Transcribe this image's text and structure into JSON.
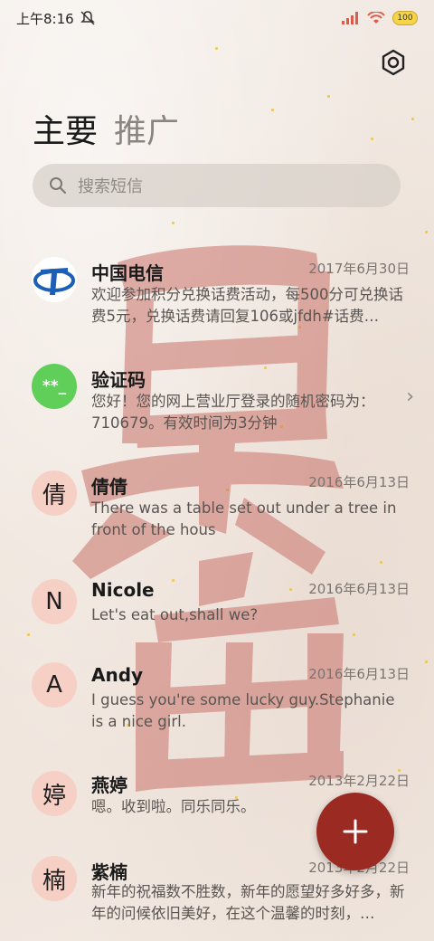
{
  "status_bar": {
    "time": "上午8:16",
    "battery": "100"
  },
  "tabs": [
    {
      "label": "主要",
      "active": true
    },
    {
      "label": "推广",
      "active": false
    }
  ],
  "search": {
    "placeholder": "搜索短信"
  },
  "conversations": [
    {
      "name": "中国电信",
      "date": "2017年6月30日",
      "preview": "欢迎参加积分兑换话费活动，每500分可兑换话费5元，兑换话费请回复106或jfdh#话费…",
      "avatar_type": "logo",
      "avatar_icon": "china-telecom-logo"
    },
    {
      "name": "验证码",
      "date": "",
      "preview": "您好！您的网上营业厅登录的随机密码为：710679。有效时间为3分钟",
      "avatar_type": "code",
      "avatar_text": "**_",
      "has_chevron": true
    },
    {
      "name": "倩倩",
      "date": "2016年6月13日",
      "preview": "There was a table set out under a tree in front of the hous",
      "avatar_text": "倩"
    },
    {
      "name": "Nicole",
      "date": "2016年6月13日",
      "preview": "Let's eat out,shall we?",
      "avatar_text": "N"
    },
    {
      "name": "Andy",
      "date": "2016年6月13日",
      "preview": "I guess you're some lucky guy.Stephanie is a nice girl.",
      "avatar_text": "A"
    },
    {
      "name": "燕婷",
      "date": "2013年2月22日",
      "preview": "嗯。收到啦。同乐同乐。",
      "avatar_text": "婷"
    },
    {
      "name": "紫楠",
      "date": "2013年2月22日",
      "preview": "新年的祝福数不胜数，新年的愿望好多好多，新年的问候依旧美好，在这个温馨的时刻，…",
      "avatar_text": "楠"
    }
  ],
  "colors": {
    "fab": "#9b2a22",
    "avatar_bg": "#f6cfc5",
    "code_avatar_bg": "#5fcf5a",
    "telecom_blue": "#1b5fb6"
  }
}
